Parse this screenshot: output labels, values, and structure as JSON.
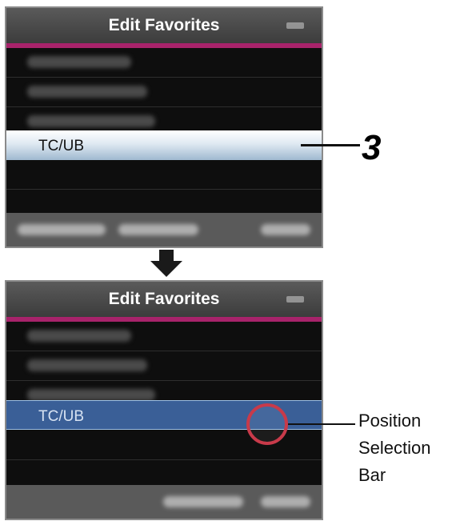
{
  "top_screen": {
    "title": "Edit Favorites",
    "selected_item": "TC/UB"
  },
  "bottom_screen": {
    "title": "Edit Favorites",
    "selected_item": "TC/UB"
  },
  "callout_step": "3",
  "annotation": {
    "line1": "Position",
    "line2": "Selection",
    "line3": "Bar"
  },
  "colors": {
    "title_rule": "#a8236b",
    "highlight_top": "#dfe9f2",
    "highlight_bottom": "#3a5f97",
    "marker": "#c83a4a"
  }
}
